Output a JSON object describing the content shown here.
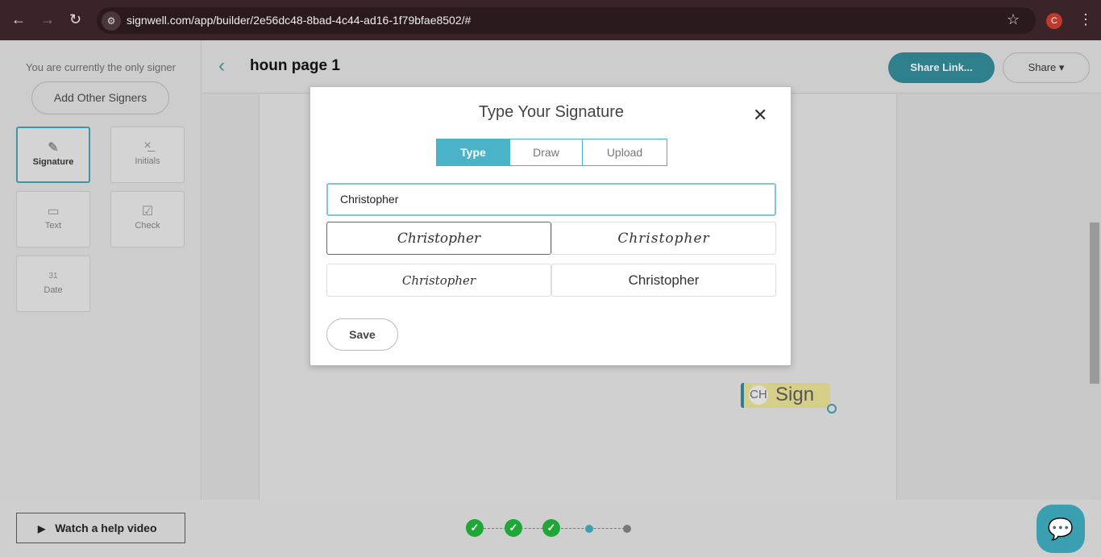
{
  "browser": {
    "url": "signwell.com/app/builder/2e56dc48-8bad-4c44-ad16-1f79bfae8502/#",
    "profile_initial": "C"
  },
  "sidebar": {
    "signer_note": "You are currently the only signer",
    "add_signers": "Add Other Signers",
    "tools": [
      {
        "label": "Signature",
        "icon": "pen-icon"
      },
      {
        "label": "Initials",
        "icon": "initials-icon"
      },
      {
        "label": "Text",
        "icon": "text-icon"
      },
      {
        "label": "Check",
        "icon": "check-icon"
      },
      {
        "label": "Date",
        "icon": "calendar-icon",
        "icon_text": "31"
      }
    ]
  },
  "header": {
    "title": "houn page 1",
    "share_link": "Share Link...",
    "share": "Share"
  },
  "field": {
    "initials": "CH",
    "label": "Sign"
  },
  "modal": {
    "title": "Type Your Signature",
    "tabs": [
      "Type",
      "Draw",
      "Upload"
    ],
    "active_tab": "Type",
    "input_value": "Christopher",
    "options": [
      "Christopher",
      "Christopher",
      "Christopher",
      "Christopher"
    ],
    "save": "Save"
  },
  "footer": {
    "help": "Watch a help video",
    "steps_completed": 3,
    "steps_total": 5
  },
  "colors": {
    "accent": "#4bb3c8",
    "success": "#1fa637",
    "browser": "#3a2329"
  }
}
